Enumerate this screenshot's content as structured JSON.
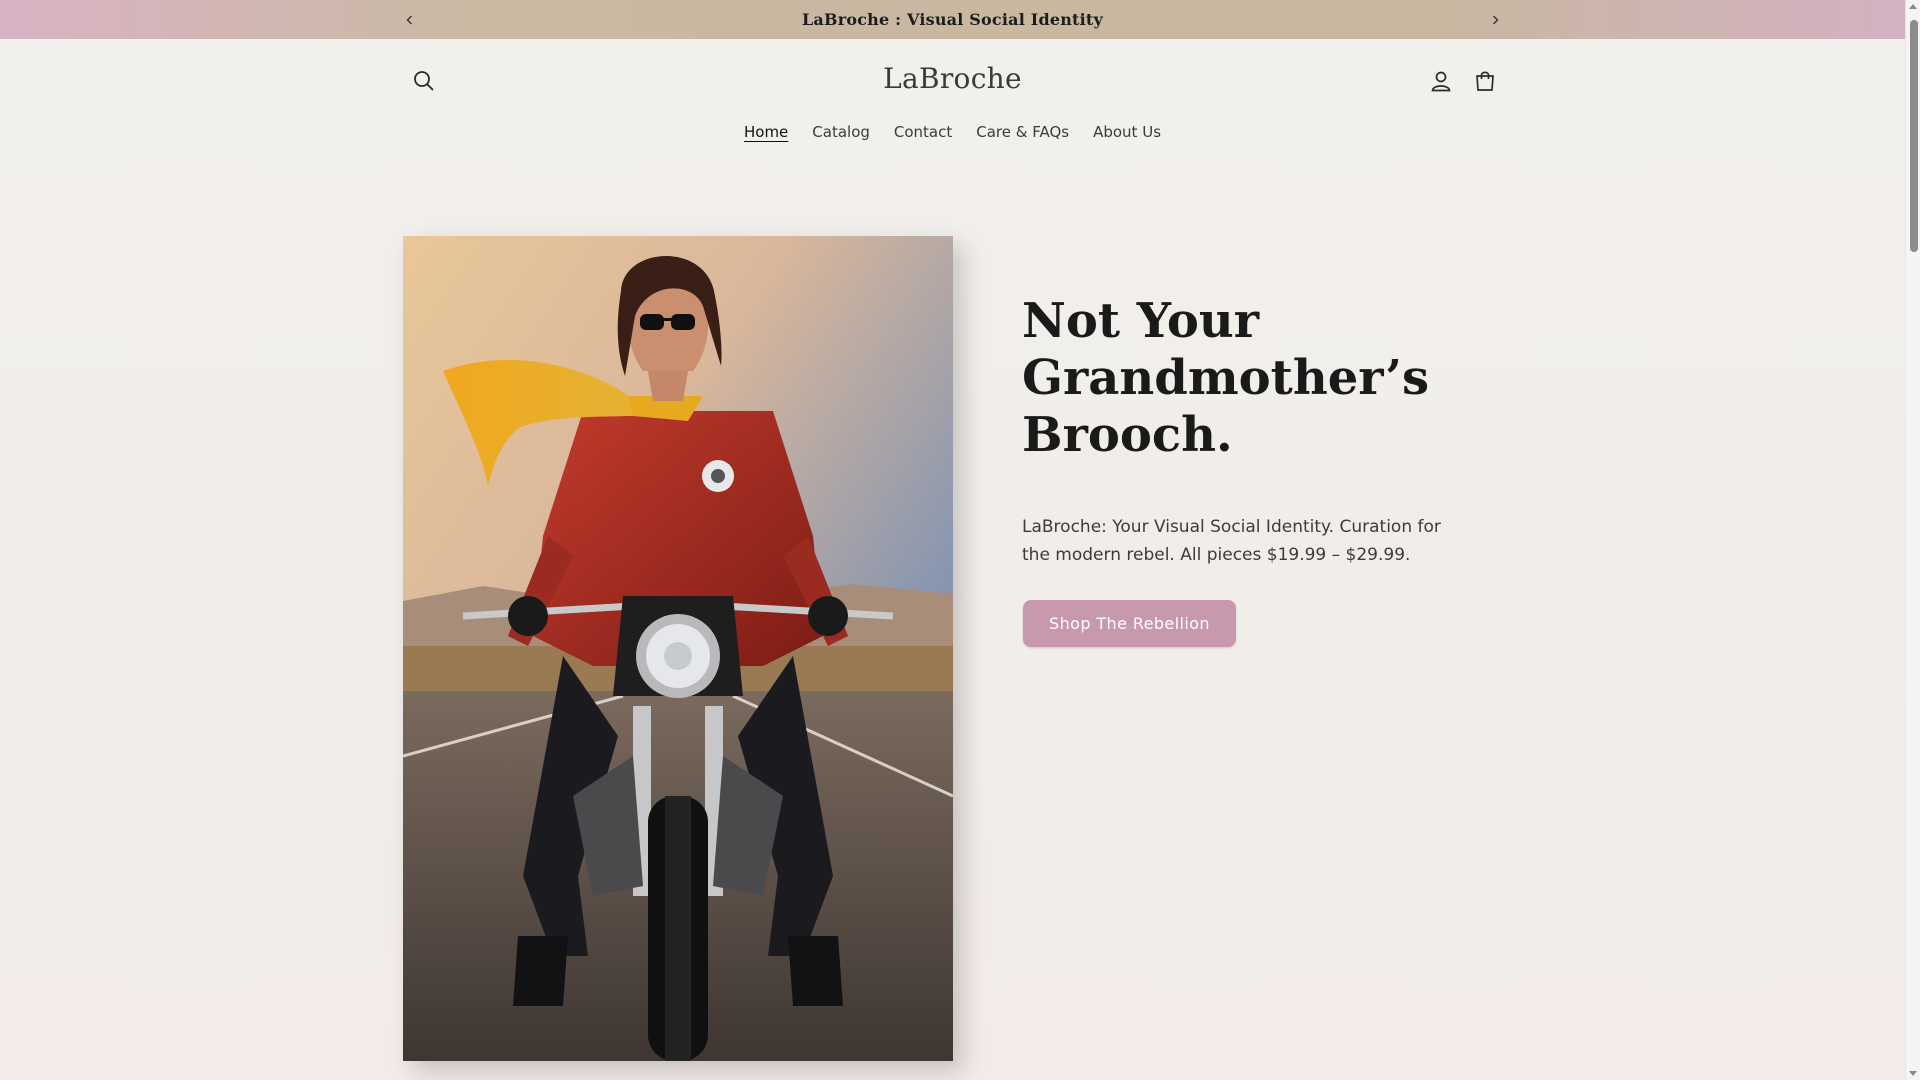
{
  "announcement": {
    "text": "LaBroche : Visual Social Identity",
    "prev_icon": "chevron-left-icon",
    "next_icon": "chevron-right-icon"
  },
  "header": {
    "logo": "LaBroche",
    "search_icon": "search-icon",
    "account_icon": "user-icon",
    "cart_icon": "cart-icon"
  },
  "nav": {
    "items": [
      {
        "label": "Home",
        "active": true
      },
      {
        "label": "Catalog",
        "active": false
      },
      {
        "label": "Contact",
        "active": false
      },
      {
        "label": "Care & FAQs",
        "active": false
      },
      {
        "label": "About Us",
        "active": false
      }
    ]
  },
  "hero": {
    "title": "Not Your Grandmother’s Brooch.",
    "description": "LaBroche: Your Visual Social Identity. Curation for the modern rebel. All pieces $19.99 – $29.99.",
    "button_label": "Shop The Rebellion",
    "image_subject": "woman in red leather jacket and yellow scarf on motorcycle on desert road"
  },
  "colors": {
    "accent": "#c898ae",
    "background": "#f2f0ec"
  }
}
